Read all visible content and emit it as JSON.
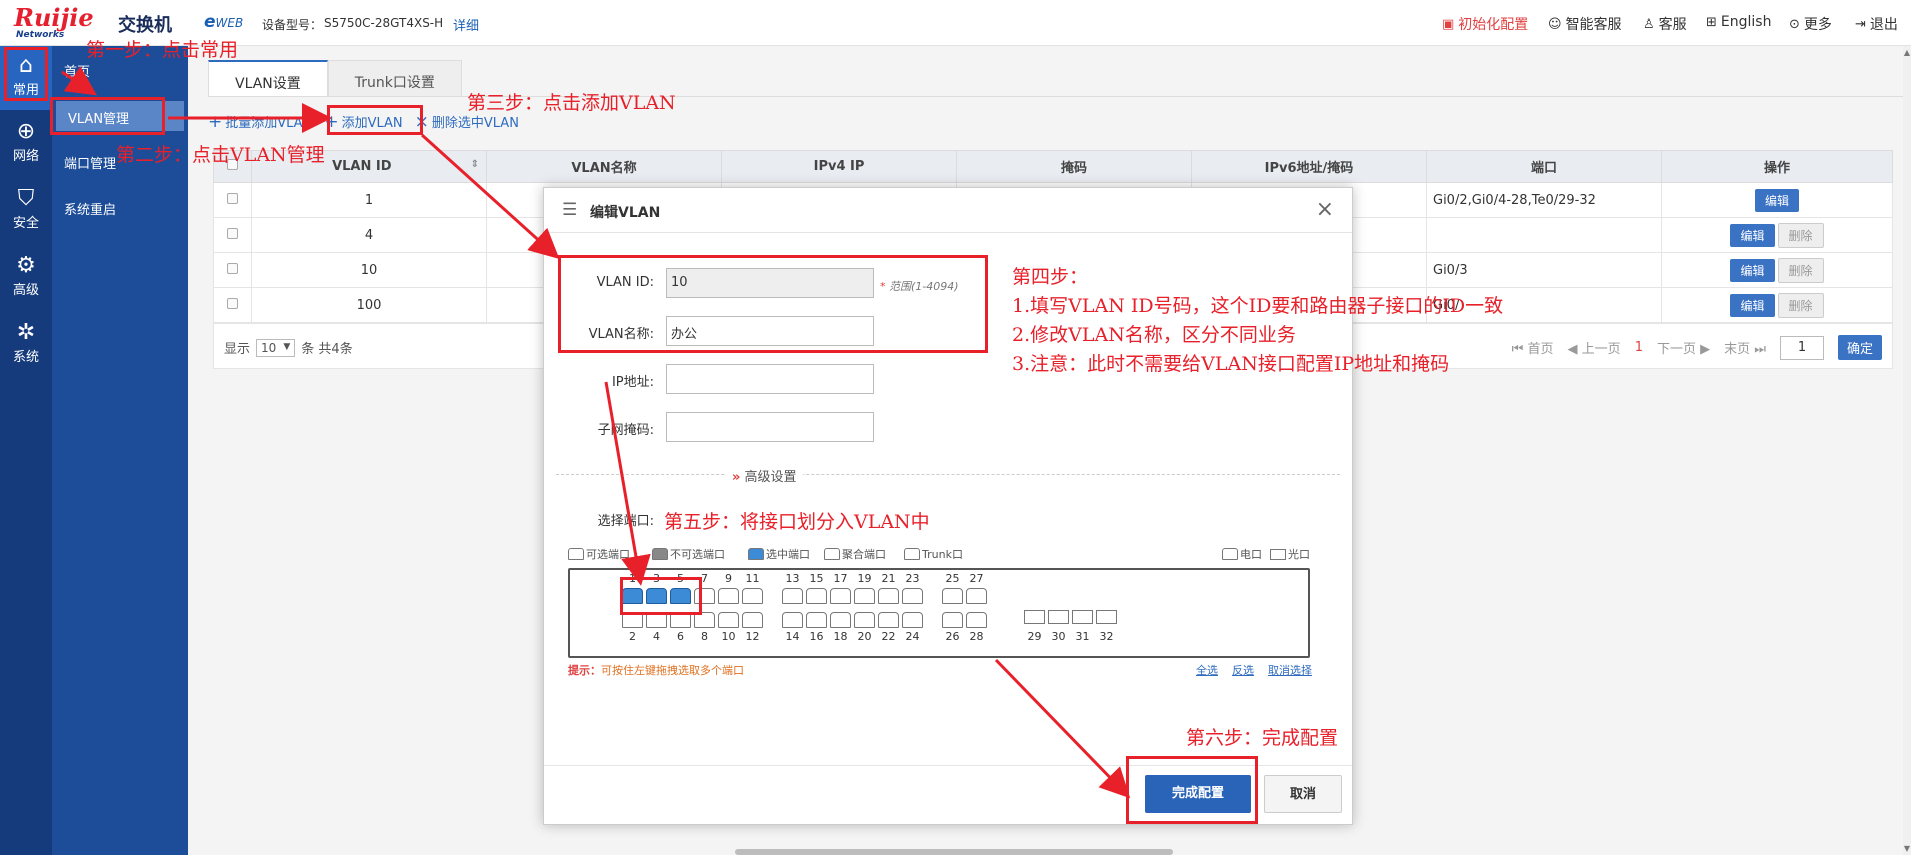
{
  "header": {
    "brand": "Ruijie",
    "brand_sub": "Networks",
    "app_title": "交换机",
    "eweb_e": "e",
    "eweb_rest": "WEB",
    "model_label": "设备型号：",
    "model_value": "S5750C-28GT4XS-H",
    "detail_link": "详细",
    "nav": [
      {
        "label": "初始化配置",
        "icon": "init-config-icon",
        "color": "#e04040"
      },
      {
        "label": "智能客服",
        "icon": "smart-service-icon"
      },
      {
        "label": "客服",
        "icon": "customer-service-icon"
      },
      {
        "label": "English",
        "icon": "language-icon"
      },
      {
        "label": "更多",
        "icon": "more-icon"
      },
      {
        "label": "退出",
        "icon": "logout-icon"
      }
    ]
  },
  "rail": {
    "items": [
      {
        "label": "常用",
        "icon": "home-icon",
        "active": true
      },
      {
        "label": "网络",
        "icon": "network-icon"
      },
      {
        "label": "安全",
        "icon": "shield-icon"
      },
      {
        "label": "高级",
        "icon": "advanced-icon"
      },
      {
        "label": "系统",
        "icon": "gear-icon"
      }
    ]
  },
  "submenu": {
    "items": [
      {
        "label": "首页"
      },
      {
        "label": "VLAN管理",
        "active": true
      },
      {
        "label": "端口管理"
      },
      {
        "label": "系统重启"
      }
    ]
  },
  "tabs": [
    {
      "label": "VLAN设置",
      "active": true
    },
    {
      "label": "Trunk口设置"
    }
  ],
  "toolbar": {
    "batch_add": "批量添加VLAN",
    "add": "添加VLAN",
    "delete_selected": "删除选中VLAN"
  },
  "table": {
    "headers": [
      "VLAN ID",
      "VLAN名称",
      "IPv4 IP",
      "掩码",
      "IPv6地址/掩码",
      "端口",
      "操作"
    ],
    "rows": [
      {
        "id": "1",
        "ports": "Gi0/2,Gi0/4-28,Te0/29-32",
        "deletable": false
      },
      {
        "id": "4",
        "ports": "",
        "deletable": true
      },
      {
        "id": "10",
        "ports": "Gi0/3",
        "deletable": true
      },
      {
        "id": "100",
        "ports": "Gi0/",
        "deletable": true
      }
    ],
    "edit_label": "编辑",
    "delete_label": "删除"
  },
  "pager": {
    "show_label": "显示",
    "page_size": "10",
    "total_text": "条 共4条",
    "first": "首页",
    "prev": "上一页",
    "current": "1",
    "next": "下一页",
    "last": "末页",
    "input_value": "1",
    "go": "确定"
  },
  "modal": {
    "title": "编辑VLAN",
    "vlan_id_label": "VLAN ID:",
    "vlan_id_value": "10",
    "range_hint": "范围(1-4094)",
    "vlan_name_label": "VLAN名称:",
    "vlan_name_value": "办公",
    "ip_label": "IP地址:",
    "ip_value": "",
    "mask_label": "子网掩码:",
    "mask_value": "",
    "advanced_label": "高级设置",
    "select_port_label": "选择端口:",
    "legend": {
      "selectable": "可选端口",
      "unselectable": "不可选端口",
      "selected": "选中端口",
      "aggregate": "聚合端口",
      "trunk": "Trunk口",
      "electric": "电口",
      "optical": "光口"
    },
    "ports_top": [
      "1",
      "3",
      "5",
      "7",
      "9",
      "11",
      "13",
      "15",
      "17",
      "19",
      "21",
      "23",
      "25",
      "27"
    ],
    "ports_bottom": [
      "2",
      "4",
      "6",
      "8",
      "10",
      "12",
      "14",
      "16",
      "18",
      "20",
      "22",
      "24",
      "26",
      "28"
    ],
    "ports_fiber": [
      "29",
      "30",
      "31",
      "32"
    ],
    "selected_ports": [
      "1",
      "3",
      "5"
    ],
    "tip_label": "提示：",
    "tip_text": "可按住左键拖拽选取多个端口",
    "select_all": "全选",
    "invert": "反选",
    "cancel_select": "取消选择",
    "done": "完成配置",
    "cancel": "取消"
  },
  "annotations": {
    "step1": "第一步：点击常用",
    "step2": "第二步：点击VLAN管理",
    "step3": "第三步：点击添加VLAN",
    "step4_title": "第四步：",
    "step4_l1": "1.填写VLAN ID号码，这个ID要和路由器子接口的ID一致",
    "step4_l2": "2.修改VLAN名称，区分不同业务",
    "step4_l3": "3.注意：此时不需要给VLAN接口配置IP地址和掩码",
    "step5": "第五步：将接口划分入VLAN中",
    "step6": "第六步：完成配置"
  },
  "colors": {
    "annotation_red": "#e8202a",
    "primary_blue": "#2a64b8",
    "rail_bg": "#163b7c",
    "submenu_bg": "#1d4d99"
  }
}
